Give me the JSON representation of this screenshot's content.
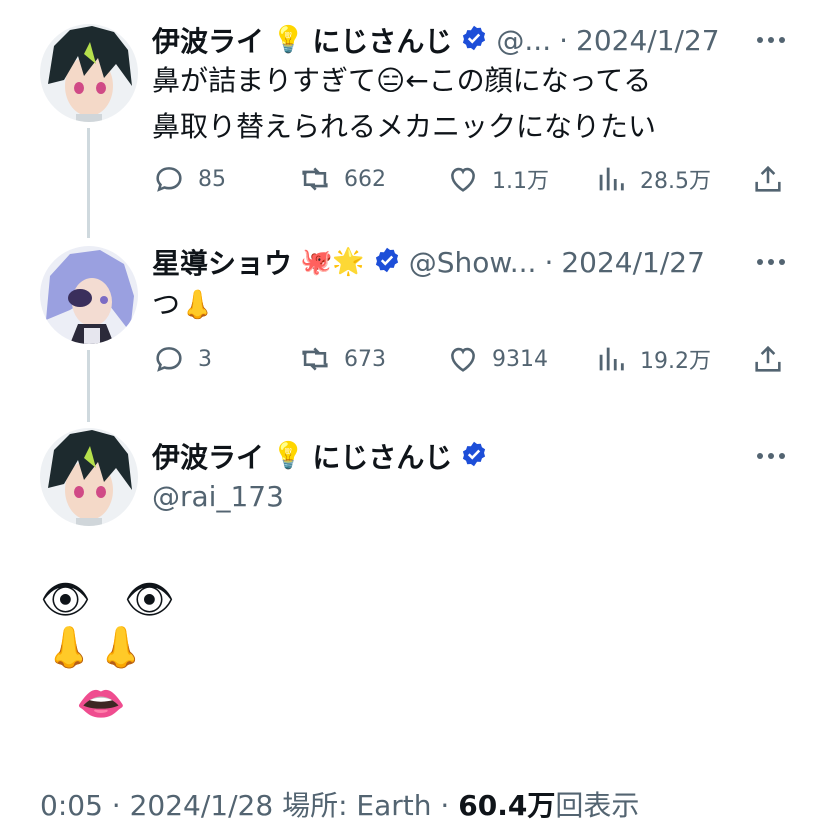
{
  "tweets": [
    {
      "name": "伊波ライ",
      "name_emoji": "💡",
      "org": "にじさんじ",
      "handle": "@...",
      "date": "2024/1/27",
      "lines": [
        "鼻が詰まりすぎて😑←この顔になってる",
        "鼻取り替えられるメカニックになりたい"
      ],
      "replies": "85",
      "retweets": "662",
      "likes": "1.1万",
      "views": "28.5万"
    },
    {
      "name": "星導ショウ",
      "name_emoji": "🐙🌟",
      "handle": "@Show...",
      "date": "2024/1/27",
      "lines": [
        "つ👃"
      ],
      "replies": "3",
      "retweets": "673",
      "likes": "9314",
      "views": "19.2万"
    }
  ],
  "main": {
    "name": "伊波ライ",
    "name_emoji": "💡",
    "org": "にじさんじ",
    "handle": "@rai_173",
    "art": {
      "eyes": [
        "👁",
        "👁"
      ],
      "noses": [
        "👃",
        "👃"
      ],
      "mouth": "👄"
    }
  },
  "footer": {
    "time": "0:05",
    "sep": "·",
    "date": "2024/1/28",
    "location": "場所: Earth",
    "views": "60.4万",
    "views_suffix": "回表示"
  },
  "colors": {
    "accent": "#1d9bf0",
    "verified": "#1d4ed8",
    "muted": "#536471"
  }
}
